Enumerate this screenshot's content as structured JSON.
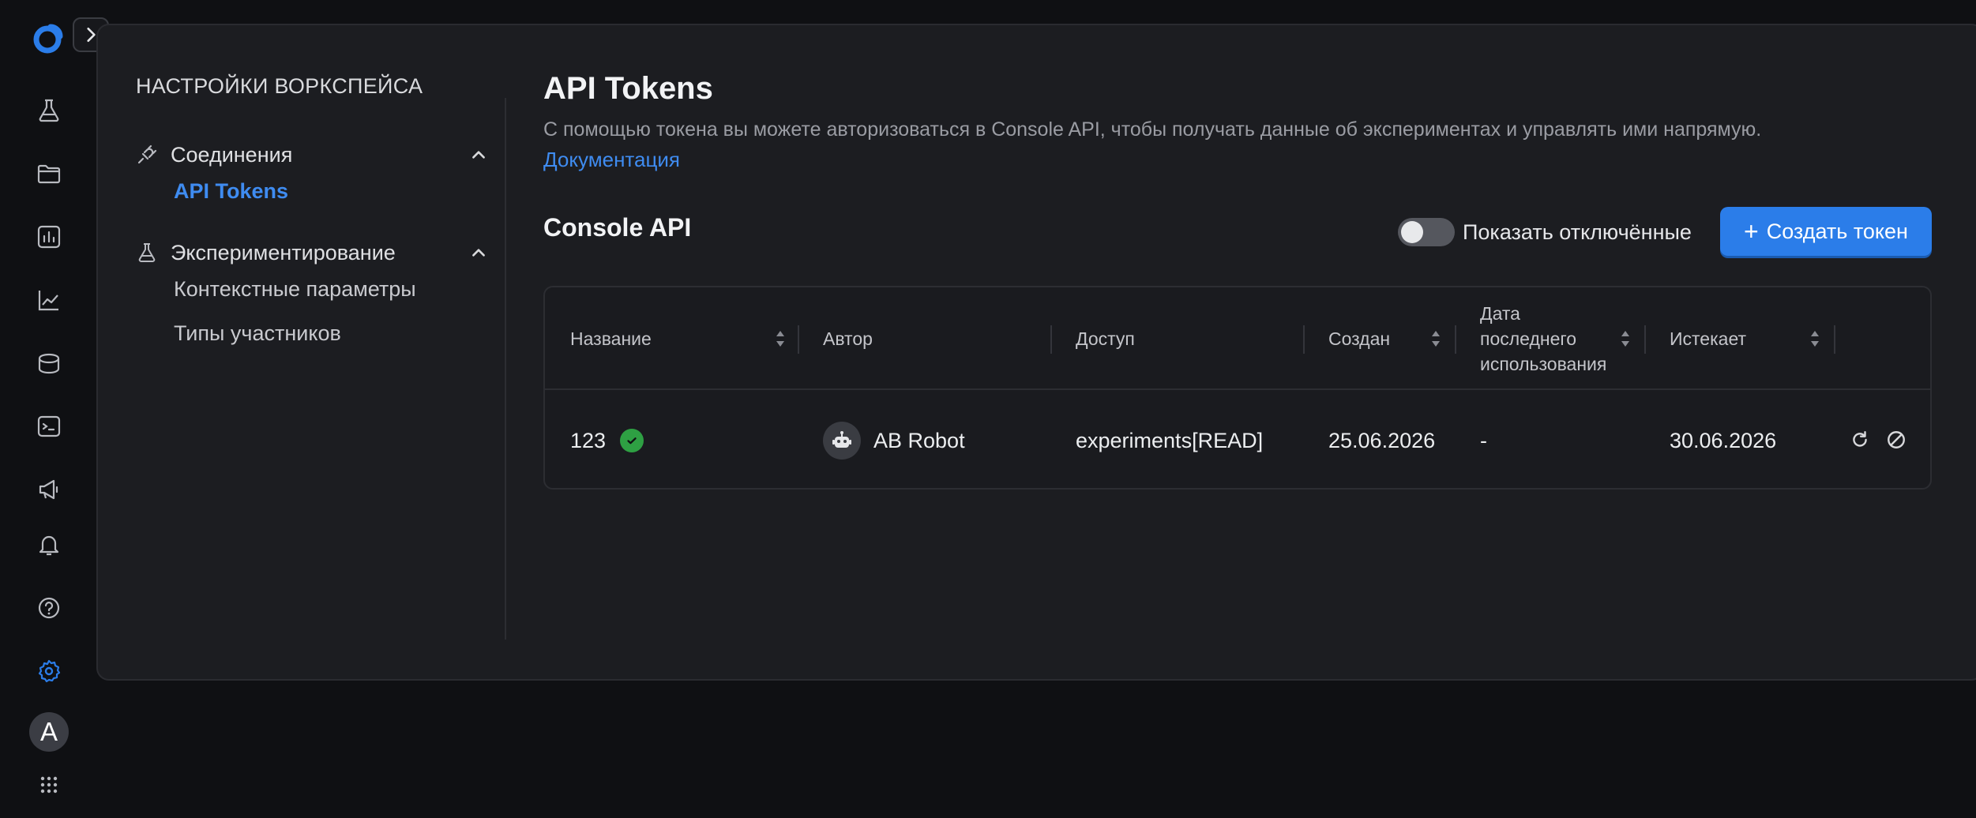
{
  "settings_nav": {
    "title": "НАСТРОЙКИ ВОРКСПЕЙСА",
    "groups": [
      {
        "label": "Соединения",
        "items": [
          {
            "label": "API Tokens"
          }
        ]
      },
      {
        "label": "Экспериментирование",
        "items": [
          {
            "label": "Контекстные параметры"
          },
          {
            "label": "Типы участников"
          }
        ]
      }
    ]
  },
  "page": {
    "title": "API Tokens",
    "description": "С помощью токена вы можете авторизоваться в Console API, чтобы получать данные об экспериментах и управлять ими напрямую.",
    "doc_link": "Документация",
    "section_title": "Console API",
    "toggle_label": "Показать отключённые",
    "toggle_on": false,
    "create_button": "Создать токен"
  },
  "table": {
    "columns": [
      {
        "label": "Название"
      },
      {
        "label": "Автор"
      },
      {
        "label": "Доступ"
      },
      {
        "label": "Создан"
      },
      {
        "label": "Дата последнего использования"
      },
      {
        "label": "Истекает"
      }
    ],
    "rows": [
      {
        "name": "123",
        "author": "AB Robot",
        "access": "experiments[READ]",
        "created": "25.06.2026",
        "last_used": "-",
        "expires": "30.06.2026"
      }
    ]
  },
  "user": {
    "avatar_letter": "A"
  },
  "colors": {
    "accent": "#2b7de9",
    "link": "#3f8cf1",
    "success": "#2ea043",
    "bg": "#0f1013",
    "panel": "#1c1d21"
  },
  "icons": {
    "rail": [
      "flask-icon",
      "folder-icon",
      "bar-chart-icon",
      "line-chart-icon",
      "package-icon",
      "terminal-icon",
      "megaphone-icon",
      "bell-icon",
      "help-icon",
      "gear-icon",
      "apps-grid-icon"
    ]
  }
}
